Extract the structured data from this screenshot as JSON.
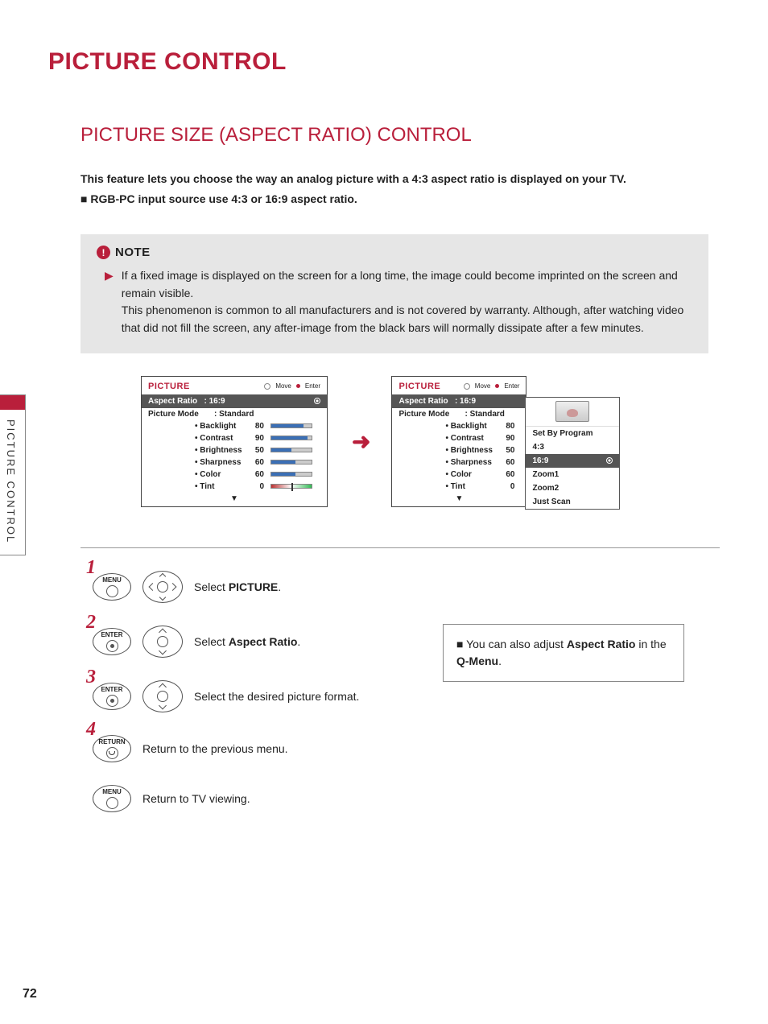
{
  "main_title": "PICTURE CONTROL",
  "section_title": "PICTURE SIZE (ASPECT RATIO) CONTROL",
  "intro_bold": "This feature lets you choose the way an analog picture with a 4:3 aspect ratio is displayed on your TV.",
  "intro_bullet": "RGB-PC input source use 4:3 or 16:9 aspect ratio.",
  "note": {
    "title": "NOTE",
    "text": "If a fixed image is displayed on the screen for a long time, the image could become imprinted on the screen and remain visible.\nThis phenomenon is common to all manufacturers and is not covered by warranty. Although, after watching video that did not fill the screen, any after-image from the black bars will normally dissipate after a few minutes."
  },
  "osd": {
    "title": "PICTURE",
    "hint_move": "Move",
    "hint_enter": "Enter",
    "aspect_label": "Aspect Ratio",
    "aspect_value": ": 16:9",
    "mode_label": "Picture Mode",
    "mode_value": ": Standard",
    "items": [
      {
        "label": "• Backlight",
        "val": "80",
        "fill": "80%"
      },
      {
        "label": "• Contrast",
        "val": "90",
        "fill": "90%"
      },
      {
        "label": "• Brightness",
        "val": "50",
        "fill": "50%"
      },
      {
        "label": "• Sharpness",
        "val": "60",
        "fill": "60%"
      },
      {
        "label": "• Color",
        "val": "60",
        "fill": "60%"
      },
      {
        "label": "• Tint",
        "val": "0",
        "tint": true
      }
    ]
  },
  "popup_options": [
    "Set By Program",
    "4:3",
    "16:9",
    "Zoom1",
    "Zoom2",
    "Just Scan"
  ],
  "popup_selected": "16:9",
  "side_tab": "PICTURE CONTROL",
  "steps": [
    {
      "num": "1",
      "btn": "MENU",
      "text_pre": "Select ",
      "strong": "PICTURE",
      "text_post": "."
    },
    {
      "num": "2",
      "btn": "ENTER",
      "text_pre": "Select ",
      "strong": "Aspect Ratio",
      "text_post": "."
    },
    {
      "num": "3",
      "btn": "ENTER",
      "text_pre": "Select the desired picture format.",
      "strong": "",
      "text_post": ""
    },
    {
      "num": "4",
      "btn": "RETURN",
      "text_pre": "Return to the previous menu.",
      "strong": "",
      "text_post": ""
    },
    {
      "num": "",
      "btn": "MENU",
      "text_pre": "Return to TV viewing.",
      "strong": "",
      "text_post": ""
    }
  ],
  "tip": {
    "pre": "You can also adjust ",
    "strong1": "Aspect Ratio",
    "mid": " in the ",
    "strong2": "Q-Menu",
    "post": "."
  },
  "page_number": "72"
}
